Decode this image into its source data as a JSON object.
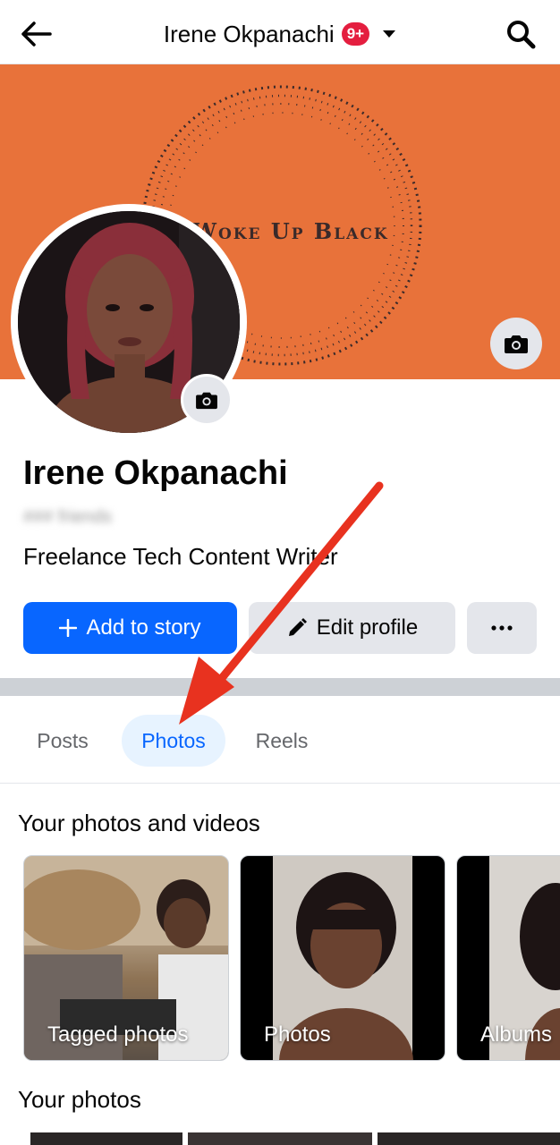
{
  "header": {
    "title": "Irene Okpanachi",
    "badge": "9+",
    "back_icon": "back-arrow-icon",
    "dropdown_icon": "caret-down-icon",
    "search_icon": "search-icon"
  },
  "cover": {
    "text": "Woke Up Black",
    "bg_color": "#e8723a"
  },
  "profile": {
    "name": "Irene Okpanachi",
    "friends": "### friends",
    "bio": "Freelance Tech Content Writer"
  },
  "actions": {
    "add_story": "Add to story",
    "edit_profile": "Edit profile",
    "more": "•••"
  },
  "tabs": [
    {
      "label": "Posts",
      "active": false
    },
    {
      "label": "Photos",
      "active": true
    },
    {
      "label": "Reels",
      "active": false
    }
  ],
  "photos_section": {
    "title": "Your photos and videos",
    "cards": [
      {
        "label": "Tagged photos"
      },
      {
        "label": "Photos"
      },
      {
        "label": "Albums"
      }
    ]
  },
  "your_photos": {
    "title": "Your photos"
  },
  "colors": {
    "primary": "#0866ff",
    "annotation_arrow": "#e8321f"
  }
}
